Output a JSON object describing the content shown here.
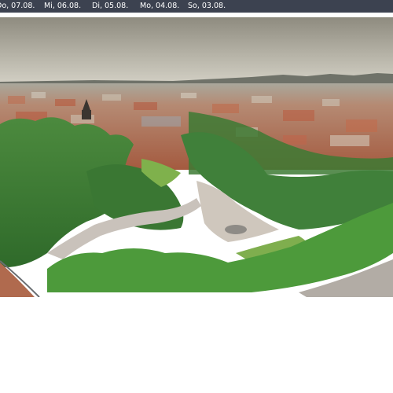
{
  "date_bar": {
    "days": [
      {
        "label": "Do, 07.08."
      },
      {
        "label": "Mi, 06.08."
      },
      {
        "label": "Di, 05.08."
      },
      {
        "label": "Mo, 04.08."
      },
      {
        "label": "So, 03.08."
      }
    ]
  },
  "colors": {
    "date_bar_bg": "#3c4250",
    "sky_top": "#8f8c7e",
    "sky_bottom": "#c9c7bb",
    "roofs": "#b25a40",
    "foliage": "#3f7d35"
  }
}
